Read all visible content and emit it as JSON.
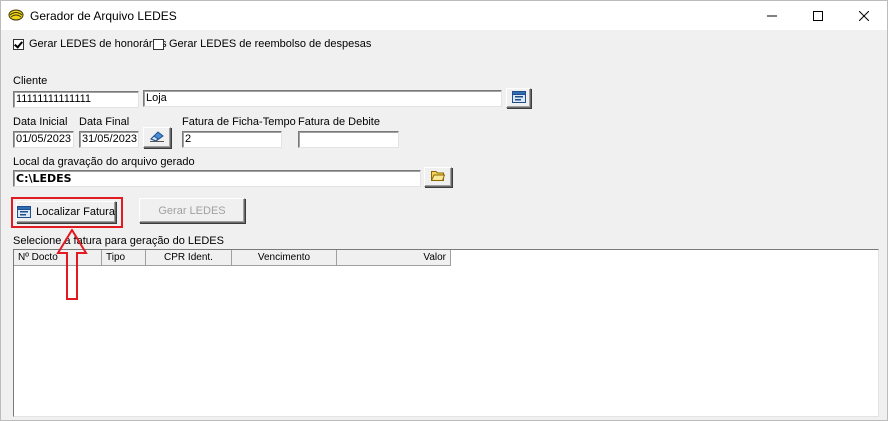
{
  "window": {
    "title": "Gerador de Arquivo LEDES",
    "app_icon": "leaf-icon"
  },
  "options": {
    "honorarios_label": "Gerar LEDES de honorários",
    "honorarios_checked": true,
    "reembolso_label": "Gerar LEDES de reembolso de despesas",
    "reembolso_checked": false
  },
  "cliente": {
    "label": "Cliente",
    "code": "11111111111111",
    "name": "Loja",
    "lookup_icon": "browse-icon"
  },
  "periodo": {
    "data_inicial_label": "Data Inicial",
    "data_inicial": "01/05/2023",
    "data_final_label": "Data Final",
    "data_final": "31/05/2023",
    "clear_icon": "eraser-icon"
  },
  "fatura": {
    "ficha_tempo_label": "Fatura de Ficha-Tempo",
    "ficha_tempo": "2",
    "debite_label": "Fatura de Debite",
    "debite": ""
  },
  "local": {
    "label": "Local da gravação do arquivo gerado",
    "path": "C:\\LEDES",
    "folder_icon": "folder-icon"
  },
  "actions": {
    "localizar_label": "Localizar Fatura",
    "gerar_label": "Gerar LEDES"
  },
  "grid": {
    "caption": "Selecione a fatura para geração do LEDES",
    "columns": [
      "Nº Docto",
      "Tipo",
      "CPR Ident.",
      "Vencimento",
      "Valor"
    ],
    "rows": []
  },
  "annotation": {
    "color": "#e21b23"
  }
}
